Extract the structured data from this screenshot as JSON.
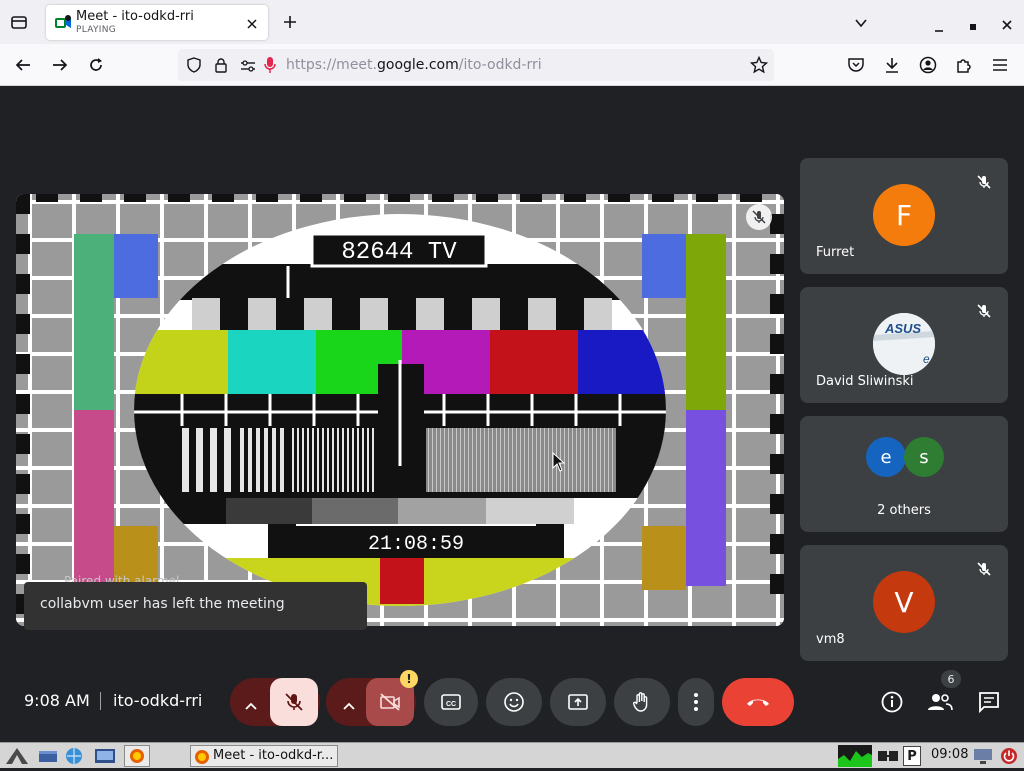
{
  "browser": {
    "tab_title": "Meet - ito-odkd-rri",
    "tab_status": "PLAYING",
    "url_prefix": "https://meet.",
    "url_domain": "google.com",
    "url_path": "/ito-odkd-rri"
  },
  "main_video": {
    "tv_label": "82644 TV",
    "tv_clock": "21:08:59",
    "overlay_text": "Paired with alarmel"
  },
  "toast": {
    "message": "collabvm user has left the meeting"
  },
  "participants": [
    {
      "name": "Furret",
      "initial": "F",
      "color": "#f47c0c",
      "muted": true
    },
    {
      "name": "David Sliwinski",
      "initial": "",
      "color": "#e8eef2",
      "muted": true
    },
    {
      "name": "2 others",
      "initials": [
        "e",
        "s"
      ],
      "colors": [
        "#1565c0",
        "#2e7d32"
      ],
      "muted": false
    },
    {
      "name": "vm8",
      "initial": "V",
      "color": "#c5390f",
      "muted": true
    }
  ],
  "meeting": {
    "time": "9:08 AM",
    "code": "ito-odkd-rri"
  },
  "controls": {
    "people_count": "6",
    "camera_warning": "!"
  },
  "taskbar": {
    "window_label": "Meet - ito-odkd-r...",
    "clock": "09:08"
  },
  "colors": {
    "accent_red": "#ea4335",
    "tile_bg": "#3c4043",
    "page_bg": "#202124"
  }
}
